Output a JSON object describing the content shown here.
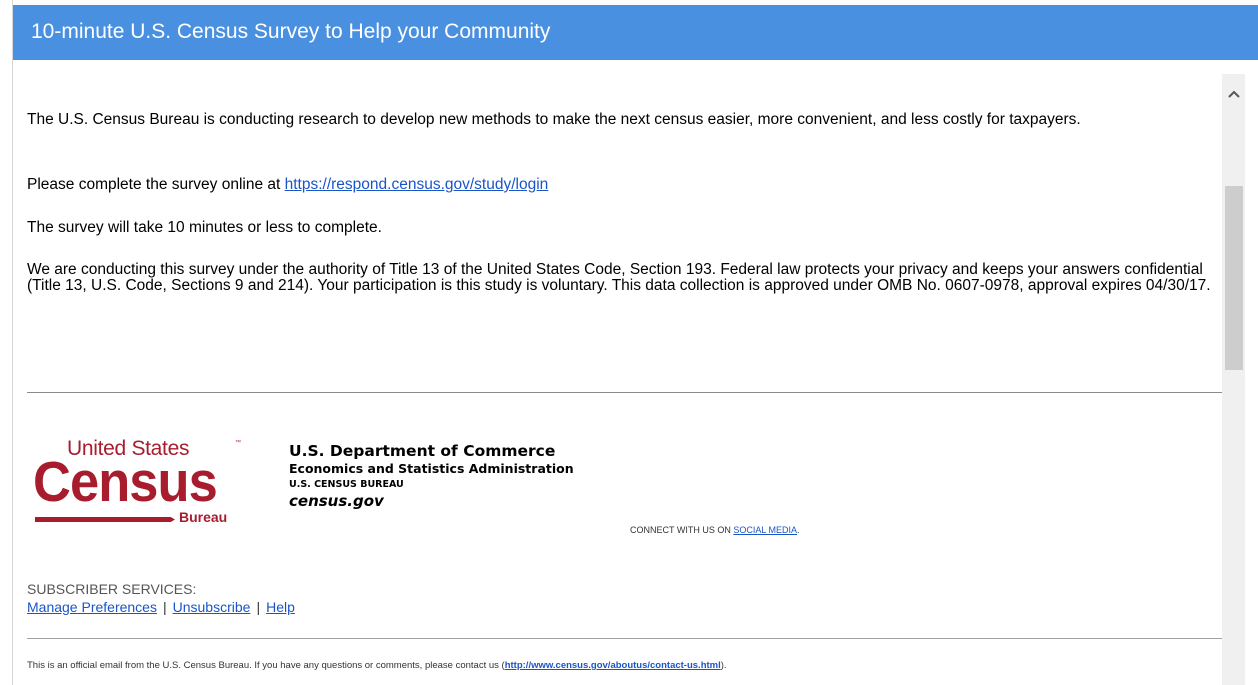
{
  "title_bar": {
    "title": "10-minute U.S. Census Survey to Help your Community"
  },
  "email": {
    "paragraph_1": "The U.S. Census Bureau is conducting research to develop new methods to make the next census easier, more convenient, and less costly for taxpayers.",
    "paragraph_2_prefix": "Please complete the survey online at ",
    "survey_link": "https://respond.census.gov/study/login",
    "paragraph_3": "The survey will take 10 minutes or less to complete.",
    "paragraph_4": "We are conducting this survey under the authority of Title 13 of the United States Code, Section 193. Federal law protects your privacy and keeps your answers confidential (Title 13, U.S. Code, Sections 9 and 214). Your participation is this study is voluntary.  This data collection is approved under OMB No. 0607-0978, approval expires 04/30/17."
  },
  "logo": {
    "line_1": "United States",
    "trademark": "™",
    "line_2": "Census",
    "line_3": "Bureau"
  },
  "department": {
    "name": "U.S. Department of Commerce",
    "administration": "Economics and Statistics Administration",
    "bureau": "U.S. CENSUS BUREAU",
    "site": "census.gov"
  },
  "connect": {
    "prefix": "CONNECT WITH US ON ",
    "link": "SOCIAL MEDIA",
    "suffix": "."
  },
  "subscriber": {
    "heading": "SUBSCRIBER SERVICES:",
    "links": [
      "Manage Preferences",
      "Unsubscribe",
      "Help"
    ],
    "separator": "|"
  },
  "footer": {
    "prefix": "This is an official email from the U.S. Census Bureau. If you have any questions or comments, please contact us (",
    "link": "http://www.census.gov/aboutus/contact-us.html",
    "suffix": ")."
  },
  "scrollbar": {
    "up_icon": "chevron-up-icon"
  },
  "colors": {
    "title_bar": "#4a90e0",
    "link": "#1a55c8",
    "census_red": "#a81d2e"
  }
}
